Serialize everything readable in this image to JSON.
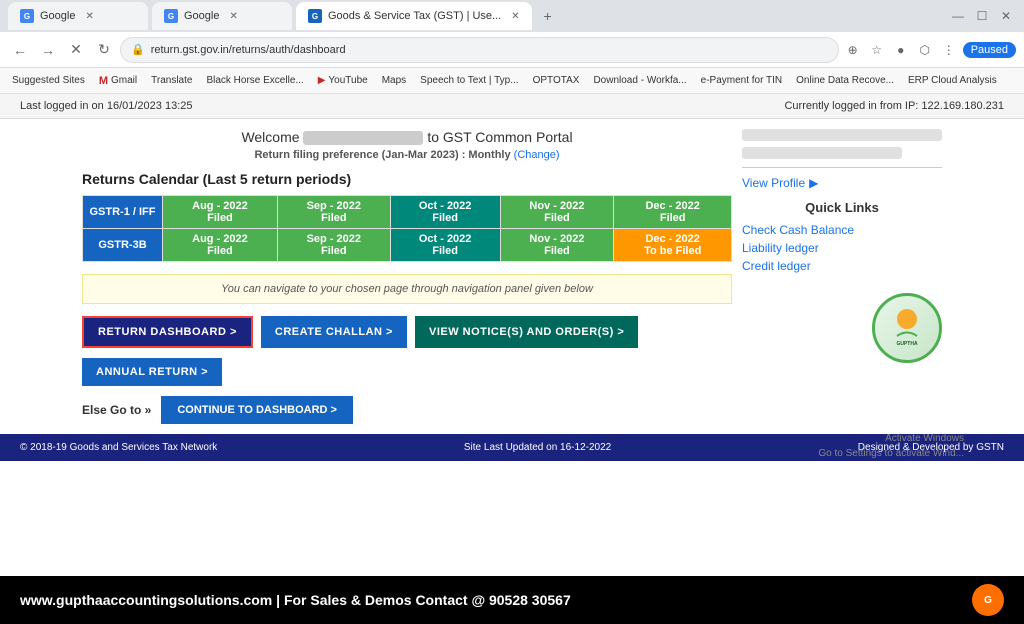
{
  "browser": {
    "tabs": [
      {
        "label": "Google",
        "favicon": "G",
        "active": false
      },
      {
        "label": "Google",
        "favicon": "G",
        "active": false
      },
      {
        "label": "Goods & Service Tax (GST) | Use...",
        "favicon": "GST",
        "active": true
      }
    ],
    "address": "return.gst.gov.in/returns/auth/dashboard",
    "paused_label": "Paused"
  },
  "bookmarks": [
    "Suggested Sites",
    "Gmail",
    "Translate",
    "Black Horse Excelle...",
    "YouTube",
    "Maps",
    "Speech to Text | Typ...",
    "OPTOTAX",
    "Download - Workfa...",
    "e-Payment for TIN",
    "Online Data Recove...",
    "ERP Cloud Analysis"
  ],
  "top_info": {
    "last_logged": "Last logged in on 16/01/2023 13:25",
    "current_ip": "Currently logged in from IP: 122.169.180.231"
  },
  "welcome": {
    "text_before": "Welcome",
    "text_after": "to GST Common Portal",
    "return_pref": "Return filing preference (Jan-Mar 2023) : Monthly",
    "change_label": "(Change)"
  },
  "calendar": {
    "title": "Returns Calendar (Last 5 return periods)",
    "rows": [
      {
        "name": "GSTR-1 / IFF",
        "cells": [
          {
            "period": "Aug - 2022",
            "status": "Filed",
            "type": "green"
          },
          {
            "period": "Sep - 2022",
            "status": "Filed",
            "type": "green"
          },
          {
            "period": "Oct - 2022",
            "status": "Filed",
            "type": "teal"
          },
          {
            "period": "Nov - 2022",
            "status": "Filed",
            "type": "green"
          },
          {
            "period": "Dec - 2022",
            "status": "Filed",
            "type": "green"
          }
        ]
      },
      {
        "name": "GSTR-3B",
        "cells": [
          {
            "period": "Aug - 2022",
            "status": "Filed",
            "type": "green"
          },
          {
            "period": "Sep - 2022",
            "status": "Filed",
            "type": "green"
          },
          {
            "period": "Oct - 2022",
            "status": "Filed",
            "type": "teal"
          },
          {
            "period": "Nov - 2022",
            "status": "Filed",
            "type": "green"
          },
          {
            "period": "Dec - 2022",
            "status": "To be Filed",
            "type": "orange"
          }
        ]
      }
    ]
  },
  "nav_info": "You can navigate to your chosen page through navigation panel given below",
  "buttons": {
    "return_dashboard": "RETURN DASHBOARD >",
    "create_challan": "CREATE CHALLAN >",
    "view_notices": "VIEW NOTICE(S) AND ORDER(S) >",
    "annual_return": "ANNUAL RETURN >",
    "else_goto": "Else Go to »",
    "continue_dashboard": "CONTINUE TO DASHBOARD >"
  },
  "right_panel": {
    "view_profile": "View Profile",
    "quick_links_title": "Quick Links",
    "links": [
      "Check Cash Balance",
      "Liability ledger",
      "Credit ledger"
    ]
  },
  "guptha_logo": "GUPTHA\nACCOUNTING\nSOLUTIONS",
  "footer": {
    "copyright": "© 2018-19 Goods and Services Tax Network",
    "updated": "Site Last Updated on 16-12-2022",
    "designed": "Designed & Developed by GSTN"
  },
  "bottom_banner": {
    "text": "www.gupthaaccountingsolutions.com | For Sales & Demos Contact @ 90528 30567"
  },
  "windows_notice": {
    "line1": "Activate Windows",
    "line2": "Go to Settings to activate Wind..."
  }
}
